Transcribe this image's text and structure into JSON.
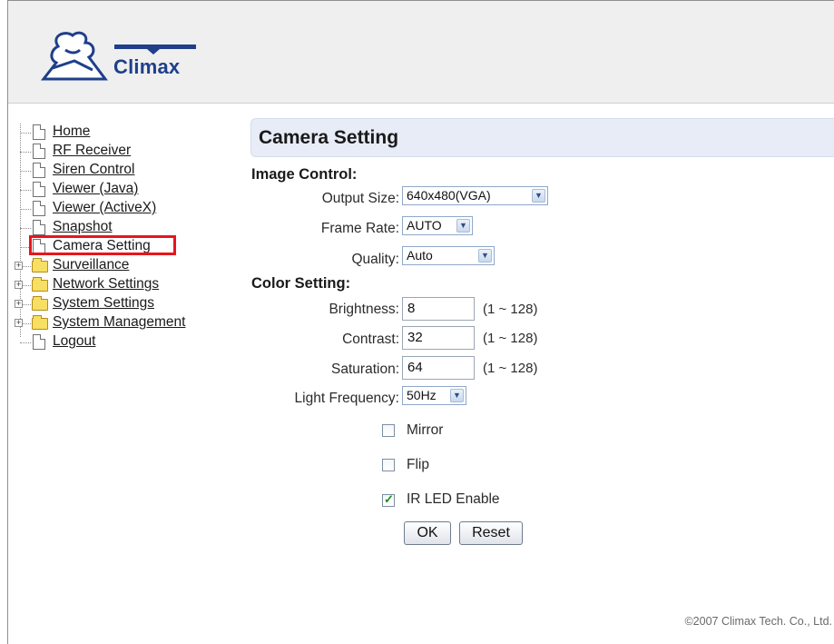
{
  "header": {
    "logo_text": "Climax"
  },
  "menu": {
    "items": [
      {
        "label": "Home",
        "type": "page"
      },
      {
        "label": "RF Receiver",
        "type": "page"
      },
      {
        "label": "Siren Control",
        "type": "page"
      },
      {
        "label": "Viewer (Java)",
        "type": "page"
      },
      {
        "label": "Viewer (ActiveX)",
        "type": "page"
      },
      {
        "label": "Snapshot",
        "type": "page"
      },
      {
        "label": "Camera Setting",
        "type": "page",
        "selected": true
      },
      {
        "label": "Surveillance",
        "type": "folder"
      },
      {
        "label": "Network Settings",
        "type": "folder"
      },
      {
        "label": "System Settings",
        "type": "folder"
      },
      {
        "label": "System Management",
        "type": "folder"
      },
      {
        "label": "Logout",
        "type": "page"
      }
    ]
  },
  "main": {
    "title": "Camera Setting",
    "image_control": {
      "heading": "Image Control:",
      "output_size": {
        "label": "Output Size:",
        "value": "640x480(VGA)"
      },
      "frame_rate": {
        "label": "Frame Rate:",
        "value": "AUTO"
      },
      "quality": {
        "label": "Quality:",
        "value": "Auto"
      }
    },
    "color_setting": {
      "heading": "Color Setting:",
      "brightness": {
        "label": "Brightness:",
        "value": "8",
        "range": "(1 ~ 128)"
      },
      "contrast": {
        "label": "Contrast:",
        "value": "32",
        "range": "(1 ~ 128)"
      },
      "saturation": {
        "label": "Saturation:",
        "value": "64",
        "range": "(1 ~ 128)"
      },
      "light_frequency": {
        "label": "Light Frequency:",
        "value": "50Hz"
      }
    },
    "options": {
      "mirror": {
        "label": "Mirror",
        "checked": false
      },
      "flip": {
        "label": "Flip",
        "checked": false
      },
      "ir_led": {
        "label": "IR LED Enable",
        "checked": true
      }
    },
    "buttons": {
      "ok": "OK",
      "reset": "Reset"
    }
  },
  "footer": {
    "copyright": "©2007 Climax Tech. Co., Ltd."
  },
  "colors": {
    "selected_outline": "#e8151c",
    "header_band": "#e7ecf7",
    "logo_blue": "#1f3f8a"
  }
}
